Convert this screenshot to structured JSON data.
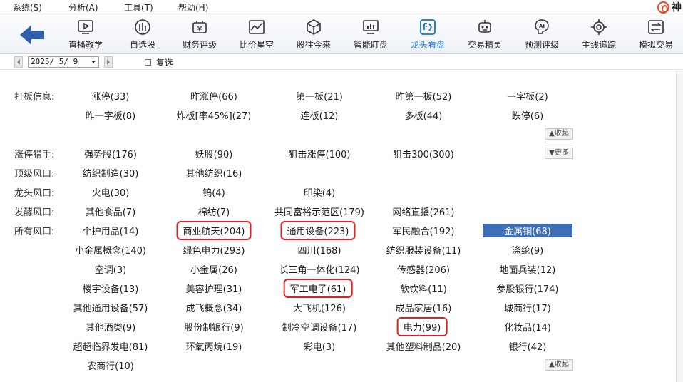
{
  "menu": {
    "items": [
      "系统(S)",
      "分析(A)",
      "工具(T)",
      "帮助(H)"
    ]
  },
  "brand": {
    "text": "神"
  },
  "toolbar": {
    "items": [
      {
        "label": "直播教学",
        "icon": "play-icon"
      },
      {
        "label": "自选股",
        "icon": "stocks-icon"
      },
      {
        "label": "财务评级",
        "icon": "finance-icon"
      },
      {
        "label": "比价星空",
        "icon": "compare-icon"
      },
      {
        "label": "股往今来",
        "icon": "cube-icon"
      },
      {
        "label": "智能盯盘",
        "icon": "monitor-icon"
      },
      {
        "label": "龙头看盘",
        "icon": "dragon-icon",
        "active": true
      },
      {
        "label": "交易精灵",
        "icon": "robot-icon"
      },
      {
        "label": "预测评级",
        "icon": "ai-icon"
      },
      {
        "label": "主线追踪",
        "icon": "target-icon"
      },
      {
        "label": "模拟交易",
        "icon": "exchange-icon"
      }
    ]
  },
  "date_row": {
    "date": "2025/ 5/ 9",
    "checkbox_label": "复选",
    "checked": false
  },
  "sections": {
    "daban": {
      "label": "打板信息:",
      "row1": [
        "涨停(33)",
        "昨涨停(66)",
        "第一板(21)",
        "昨第一板(52)",
        "一字板(2)"
      ],
      "row2": [
        "昨一字板(8)",
        "炸板[率45%](27)",
        "连板(12)",
        "多板(44)",
        "跌停(6)"
      ],
      "collapse": "收起"
    },
    "hunter": {
      "label": "涨停猎手:",
      "items": [
        "强势股(176)",
        "妖股(90)",
        "狙击涨停(100)",
        "狙击300(300)"
      ],
      "more": "更多"
    },
    "top": {
      "label": "顶级风口:",
      "items": [
        "纺织制造(30)",
        "其他纺织(16)"
      ]
    },
    "leader": {
      "label": "龙头风口:",
      "items": [
        "火电(30)",
        "钨(4)",
        "印染(4)"
      ]
    },
    "ferment": {
      "label": "发酵风口:",
      "items": [
        "其他食品(7)",
        "棉纺(7)",
        "共同富裕示范区(179)",
        "网络直播(261)"
      ]
    },
    "all": {
      "label": "所有风口:",
      "rows": [
        [
          "个护用品(14)",
          "商业航天(204)",
          "通用设备(223)",
          "军民融合(192)",
          "金属铜(68)"
        ],
        [
          "小金属概念(140)",
          "绿色电力(293)",
          "四川(168)",
          "纺织服装设备(11)",
          "涤纶(9)"
        ],
        [
          "空调(3)",
          "小金属(26)",
          "长三角一体化(124)",
          "传感器(206)",
          "地面兵装(12)"
        ],
        [
          "楼宇设备(13)",
          "美容护理(31)",
          "军工电子(61)",
          "软饮料(11)",
          "参股银行(174)"
        ],
        [
          "其他通用设备(57)",
          "成飞概念(34)",
          "大飞机(126)",
          "成品家居(16)",
          "城商行(17)"
        ],
        [
          "其他酒类(9)",
          "股份制银行(9)",
          "制冷空调设备(17)",
          "电力(99)",
          "化妆品(14)"
        ],
        [
          "超超临界发电(81)",
          "环氧丙烷(19)",
          "彩电(3)",
          "其他塑料制品(20)",
          "银行(42)"
        ],
        [
          "农商行(10)"
        ]
      ],
      "collapse": "收起",
      "selected": "金属铜(68)",
      "highlighted": [
        "商业航天(204)",
        "通用设备(223)",
        "军工电子(61)",
        "电力(99)"
      ]
    }
  },
  "colors": {
    "accent": "#1a6fd0",
    "selected_bg": "#3e6fb6",
    "highlight_box": "#e02020",
    "brand": "#e34b2a"
  }
}
